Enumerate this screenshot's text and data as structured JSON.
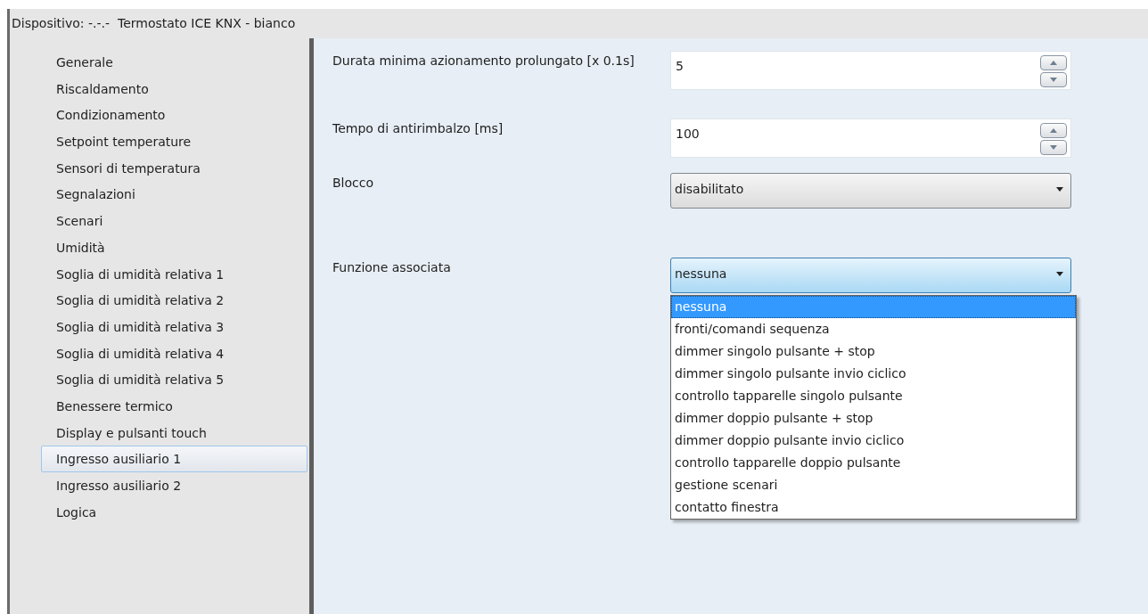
{
  "window": {
    "title": "Dispositivo: -.-.-  Termostato ICE KNX - bianco"
  },
  "sidebar": {
    "items": [
      {
        "label": "Generale",
        "selected": false
      },
      {
        "label": "Riscaldamento",
        "selected": false
      },
      {
        "label": "Condizionamento",
        "selected": false
      },
      {
        "label": "Setpoint temperature",
        "selected": false
      },
      {
        "label": "Sensori di temperatura",
        "selected": false
      },
      {
        "label": "Segnalazioni",
        "selected": false
      },
      {
        "label": "Scenari",
        "selected": false
      },
      {
        "label": "Umidità",
        "selected": false
      },
      {
        "label": "Soglia di umidità relativa 1",
        "selected": false
      },
      {
        "label": "Soglia di umidità relativa 2",
        "selected": false
      },
      {
        "label": "Soglia di umidità relativa 3",
        "selected": false
      },
      {
        "label": "Soglia di umidità relativa 4",
        "selected": false
      },
      {
        "label": "Soglia di umidità relativa 5",
        "selected": false
      },
      {
        "label": "Benessere termico",
        "selected": false
      },
      {
        "label": "Display e pulsanti touch",
        "selected": false
      },
      {
        "label": "Ingresso ausiliario 1",
        "selected": true
      },
      {
        "label": "Ingresso ausiliario 2",
        "selected": false
      },
      {
        "label": "Logica",
        "selected": false
      }
    ]
  },
  "parameters": [
    {
      "kind": "spin",
      "label": "Durata minima azionamento prolungato [x 0.1s]",
      "value": "5"
    },
    {
      "kind": "spin",
      "label": "Tempo di antirimbalzo [ms]",
      "value": "100"
    },
    {
      "kind": "combo",
      "label": "Blocco",
      "value": "disabilitato",
      "expanded": false
    },
    {
      "kind": "combo",
      "label": "Funzione associata",
      "value": "nessuna",
      "expanded": true,
      "options": [
        {
          "label": "nessuna",
          "selected": true
        },
        {
          "label": "fronti/comandi sequenza",
          "selected": false
        },
        {
          "label": "dimmer singolo pulsante + stop",
          "selected": false
        },
        {
          "label": "dimmer singolo pulsante invio ciclico",
          "selected": false
        },
        {
          "label": "controllo tapparelle singolo pulsante",
          "selected": false
        },
        {
          "label": "dimmer doppio pulsante + stop",
          "selected": false
        },
        {
          "label": "dimmer doppio pulsante invio ciclico",
          "selected": false
        },
        {
          "label": "controllo tapparelle doppio pulsante",
          "selected": false
        },
        {
          "label": "gestione scenari",
          "selected": false
        },
        {
          "label": "contatto finestra",
          "selected": false
        }
      ]
    }
  ]
}
